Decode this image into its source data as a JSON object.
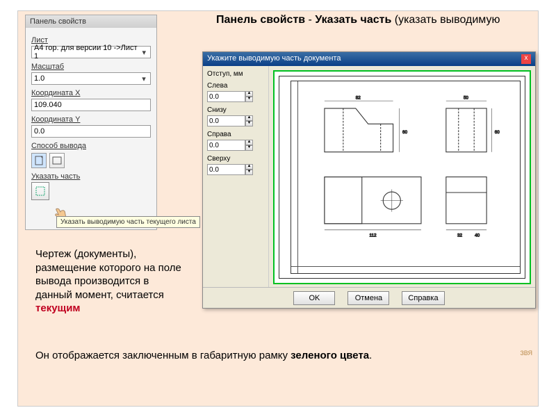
{
  "slide": {
    "heading_prefix": "Панель свойств",
    "heading_mid": " - ",
    "heading_bold2": "Указать часть",
    "heading_suffix": " (указать выводимую",
    "signature": "ЗВЯ"
  },
  "desc": {
    "p1a": "Чертеж (документы), размещение которого на поле вывода производится в данный момент, считается ",
    "p1b": "текущим",
    "p2a": "Он отображается заключенным в габаритную рамку ",
    "p2b": "зеленого цвета",
    "p2c": "."
  },
  "props": {
    "title": "Панель свойств",
    "list_label": "Лист",
    "list_value": "А4 гор. для версии 10 ->Лист 1",
    "scale_label": "Масштаб",
    "scale_value": "1.0",
    "x_label": "Координата X",
    "x_value": "109.040",
    "y_label": "Координата Y",
    "y_value": "0.0",
    "mode_label": "Способ вывода",
    "part_label": "Указать часть",
    "tooltip": "Указать выводимую часть текущего листа"
  },
  "dialog": {
    "title": "Укажите выводимую часть документа",
    "margin_header": "Отступ, мм",
    "left_label": "Слева",
    "left_value": "0.0",
    "bottom_label": "Снизу",
    "bottom_value": "0.0",
    "right_label": "Справа",
    "right_value": "0.0",
    "top_label": "Сверху",
    "top_value": "0.0",
    "ok": "OK",
    "cancel": "Отмена",
    "help": "Справка"
  },
  "icons": {
    "chevron": "▾",
    "close": "x",
    "up": "▲",
    "down": "▼",
    "page": "▭",
    "rect": "❑"
  }
}
